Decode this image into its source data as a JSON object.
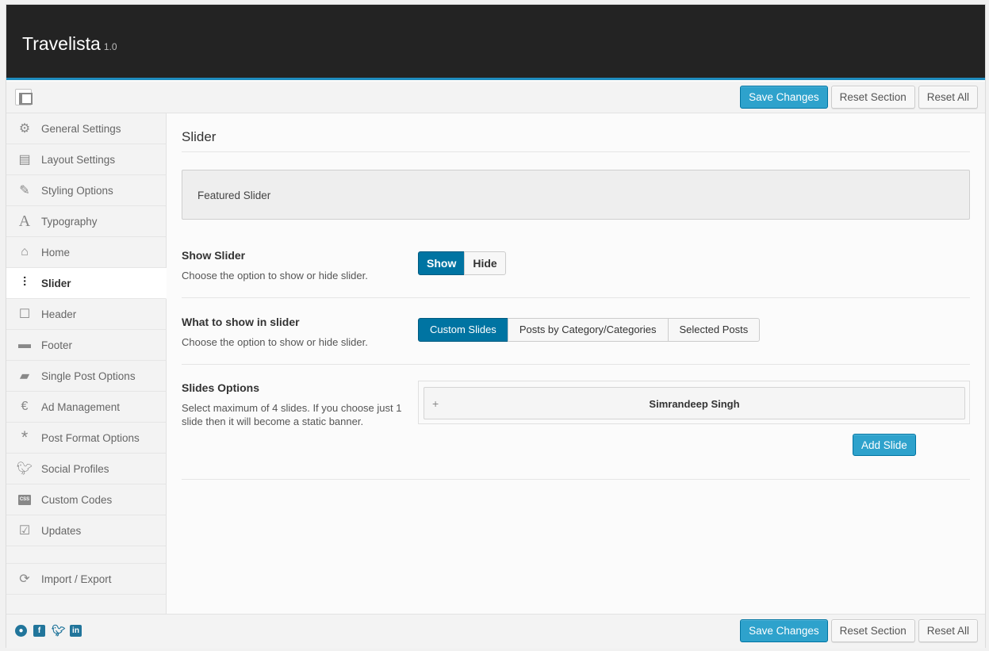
{
  "app": {
    "title": "Travelista",
    "version": "1.0"
  },
  "toolbar": {
    "save_label": "Save Changes",
    "reset_section_label": "Reset Section",
    "reset_all_label": "Reset All"
  },
  "sidebar": {
    "items": [
      {
        "label": "General Settings",
        "icon": "gears-icon"
      },
      {
        "label": "Layout Settings",
        "icon": "layout-icon"
      },
      {
        "label": "Styling Options",
        "icon": "brush-icon"
      },
      {
        "label": "Typography",
        "icon": "typography-icon"
      },
      {
        "label": "Home",
        "icon": "home-icon"
      },
      {
        "label": "Slider",
        "icon": "sliders-icon",
        "active": true
      },
      {
        "label": "Header",
        "icon": "square-icon"
      },
      {
        "label": "Footer",
        "icon": "minus-icon"
      },
      {
        "label": "Single Post Options",
        "icon": "folder-icon"
      },
      {
        "label": "Ad Management",
        "icon": "euro-icon"
      },
      {
        "label": "Post Format Options",
        "icon": "asterisk-icon"
      },
      {
        "label": "Social Profiles",
        "icon": "twitter-icon"
      },
      {
        "label": "Custom Codes",
        "icon": "css-icon"
      },
      {
        "label": "Updates",
        "icon": "checkbox-icon"
      }
    ],
    "import_export_label": "Import / Export"
  },
  "main": {
    "section_title": "Slider",
    "featured_label": "Featured Slider",
    "show_slider": {
      "title": "Show Slider",
      "desc": "Choose the option to show or hide slider.",
      "options": [
        "Show",
        "Hide"
      ],
      "selected": "Show"
    },
    "what_to_show": {
      "title": "What to show in slider",
      "desc": "Choose the option to show or hide slider.",
      "options": [
        "Custom Slides",
        "Posts by Category/Categories",
        "Selected Posts"
      ],
      "selected": "Custom Slides"
    },
    "slides_options": {
      "title": "Slides Options",
      "desc": "Select maximum of 4 slides. If you choose just 1 slide then it will become a static banner.",
      "slides": [
        {
          "name": "Simrandeep Singh"
        }
      ],
      "add_label": "Add Slide"
    }
  },
  "colors": {
    "header_bg": "#232323",
    "accent": "#2ea2cc",
    "selected": "#0074a2"
  }
}
